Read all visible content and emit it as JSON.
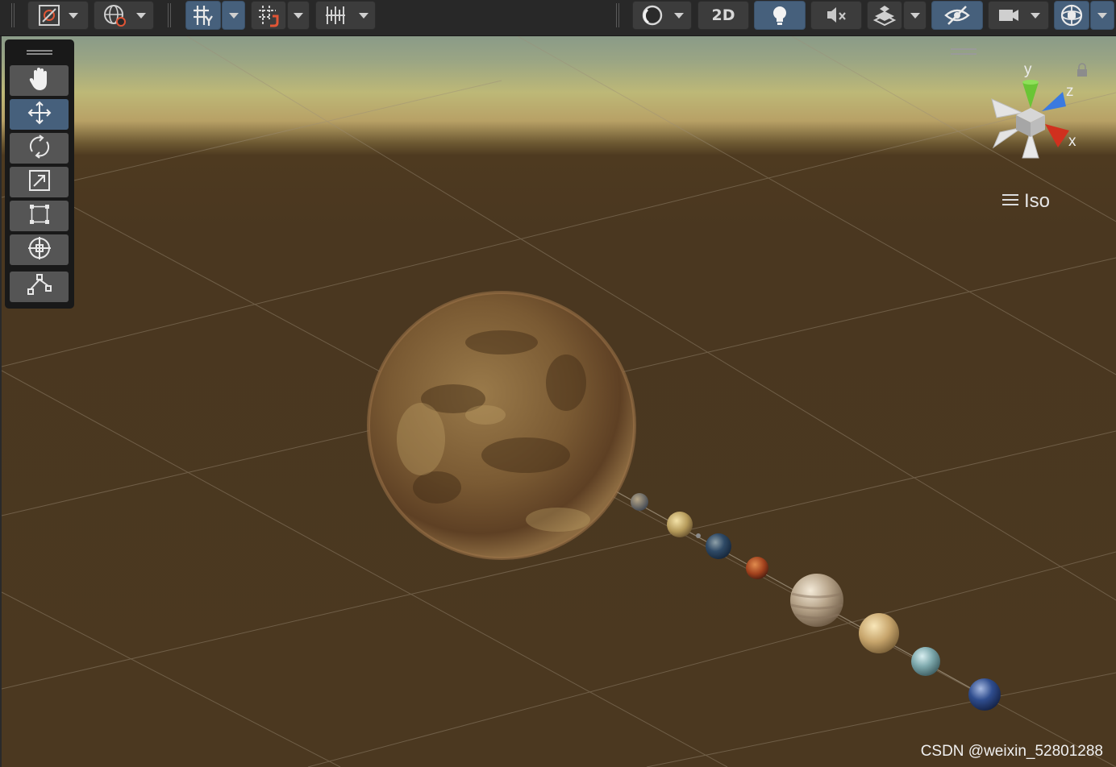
{
  "toolbar": {
    "draw_mode_icon": "draw-mode-icon",
    "global_icon": "globe-icon",
    "grid_snap_icon": "grid-snap-icon",
    "increment_snap_icon": "increment-snap-icon",
    "vertex_snap_icon": "ruler-snap-icon",
    "shading_icon": "sphere-shading-icon",
    "toggle_2d_label": "2D",
    "lighting_icon": "lightbulb-icon",
    "audio_icon": "audio-mute-icon",
    "effects_icon": "effects-layers-icon",
    "visibility_icon": "hidden-eye-icon",
    "camera_icon": "camera-icon",
    "gizmos_icon": "gizmo-globe-icon"
  },
  "tools": [
    {
      "name": "hand-tool",
      "icon": "hand-icon",
      "active": false
    },
    {
      "name": "move-tool",
      "icon": "move-arrows-icon",
      "active": true
    },
    {
      "name": "rotate-tool",
      "icon": "rotate-icon",
      "active": false
    },
    {
      "name": "scale-tool",
      "icon": "scale-icon",
      "active": false
    },
    {
      "name": "rect-tool",
      "icon": "rect-transform-icon",
      "active": false
    },
    {
      "name": "transform-tool",
      "icon": "transform-icon",
      "active": false
    },
    {
      "name": "custom-tool",
      "icon": "path-editor-icon",
      "active": false
    }
  ],
  "gizmo": {
    "axis_y": "y",
    "axis_z": "z",
    "axis_x": "x",
    "colors": {
      "x": "#d0301e",
      "y": "#6ac535",
      "z": "#3a7ae0"
    }
  },
  "view": {
    "projection_label": "Iso"
  },
  "scene": {
    "objects": [
      "Sun",
      "Mercury",
      "Venus",
      "Earth",
      "Mars",
      "Jupiter",
      "Saturn",
      "Uranus",
      "Neptune"
    ]
  },
  "watermark": "CSDN @weixin_52801288",
  "colors": {
    "accent": "#46607c",
    "toolbar_bg": "#282828",
    "button_bg": "#3c3c3c",
    "ground": "#4b3820"
  }
}
